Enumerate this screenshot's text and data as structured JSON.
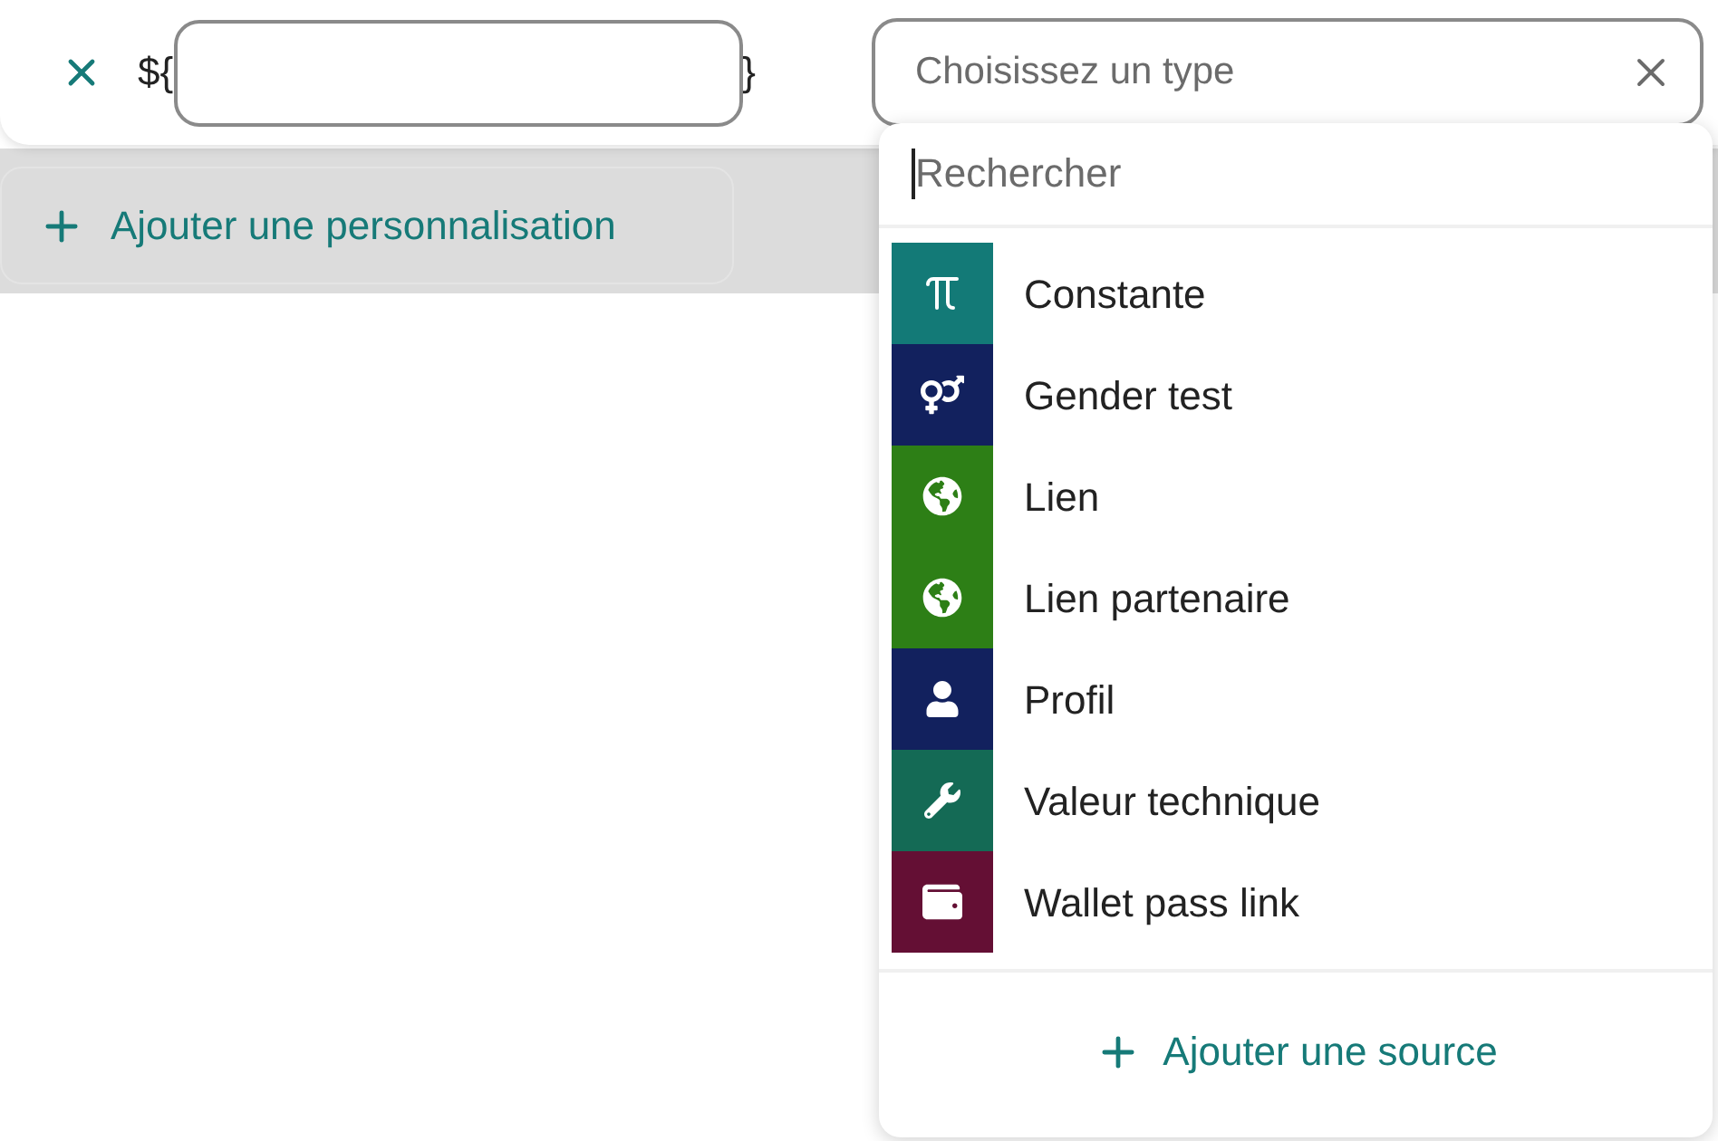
{
  "expression": {
    "prefix": "${",
    "suffix": "}"
  },
  "add_customization_button": {
    "label": "Ajouter une personnalisation"
  },
  "type_select": {
    "placeholder": "Choisissez un type",
    "expanded": true,
    "search": {
      "placeholder": "Rechercher"
    },
    "options": [
      {
        "label": "Constante",
        "kind": "constant",
        "color": "#137a77"
      },
      {
        "label": "Gender test",
        "kind": "gender",
        "color": "#12215e"
      },
      {
        "label": "Lien",
        "kind": "link",
        "color": "#2d7f16"
      },
      {
        "label": "Lien partenaire",
        "kind": "link",
        "color": "#2d7f16"
      },
      {
        "label": "Profil",
        "kind": "profile",
        "color": "#12215e"
      },
      {
        "label": "Valeur technique",
        "kind": "technical",
        "color": "#146a55"
      },
      {
        "label": "Wallet pass link",
        "kind": "wallet",
        "color": "#640f34"
      }
    ],
    "add_source_button": {
      "label": "Ajouter une source"
    }
  }
}
